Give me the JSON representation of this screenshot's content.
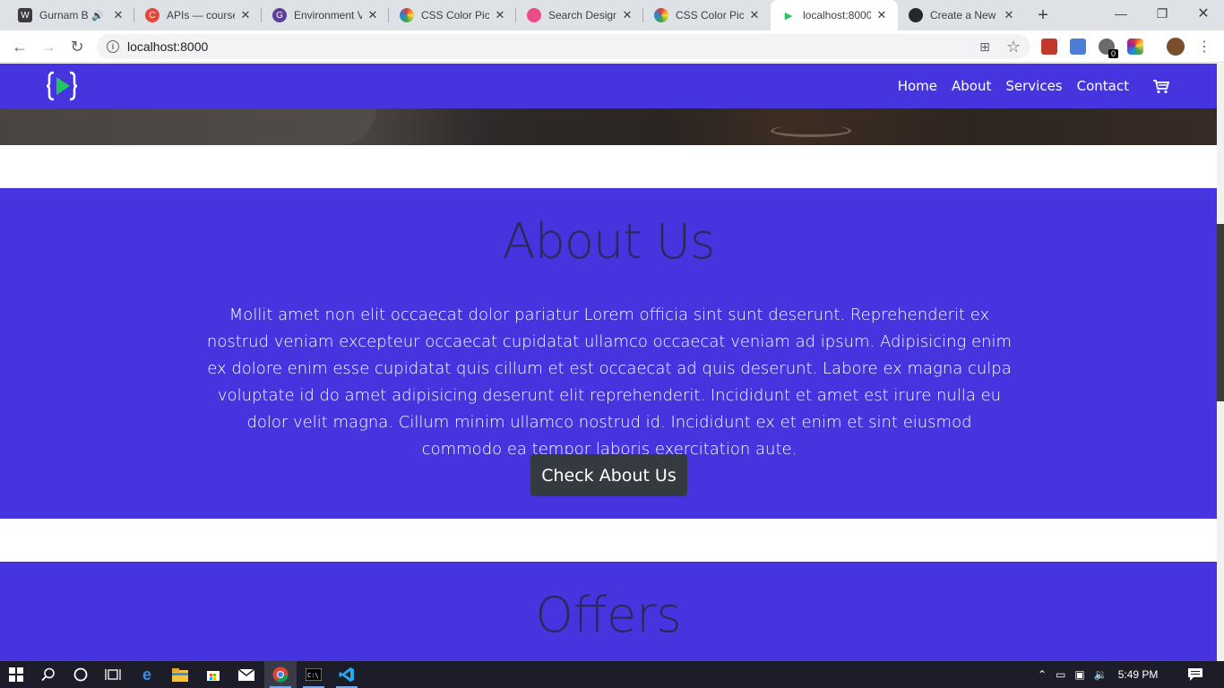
{
  "browser": {
    "tabs": [
      {
        "title": "Gurnam B",
        "favicon_color": "#3c3c3c",
        "favicon_glyph": "W",
        "audio": true
      },
      {
        "title": "APIs — course",
        "favicon_color": "#e8453c",
        "favicon_glyph": "C"
      },
      {
        "title": "Environment V",
        "favicon_color": "#5b3f99",
        "favicon_glyph": "G"
      },
      {
        "title": "CSS Color Pick",
        "favicon_color": "#7a8c3a",
        "favicon_glyph": "●"
      },
      {
        "title": "Search Design",
        "favicon_color": "#ea4c89",
        "favicon_glyph": "●"
      },
      {
        "title": "CSS Color Pick",
        "favicon_color": "#7a8c3a",
        "favicon_glyph": "●"
      },
      {
        "title": "localhost:8000",
        "favicon_color": "#ffffff",
        "favicon_glyph": "▶",
        "active": true
      },
      {
        "title": "Create a New",
        "favicon_color": "#24292e",
        "favicon_glyph": "●"
      }
    ],
    "new_tab_label": "+",
    "url": "localhost:8000",
    "extension_badge": "0"
  },
  "site": {
    "nav": {
      "links": [
        "Home",
        "About",
        "Services",
        "Contact"
      ]
    },
    "about": {
      "heading": "About Us",
      "body": "Mollit amet non elit occaecat dolor pariatur Lorem officia sint sunt deserunt. Reprehenderit ex nostrud veniam excepteur occaecat cupidatat ullamco occaecat veniam ad ipsum. Adipisicing enim ex dolore enim esse cupidatat quis cillum et est occaecat ad quis deserunt. Labore ex magna culpa voluptate id do amet adipisicing deserunt elit reprehenderit. Incididunt et amet est irure nulla eu dolor velit magna. Cillum minim ullamco nostrud id. Incididunt ex et enim et sint eiusmod commodo ea tempor laboris exercitation aute.",
      "button": "Check About Us"
    },
    "offers": {
      "heading": "Offers"
    },
    "colors": {
      "brand": "#4634de",
      "heading": "#2a2a55",
      "button": "#343a40"
    }
  },
  "taskbar": {
    "time": "5:49 PM"
  }
}
